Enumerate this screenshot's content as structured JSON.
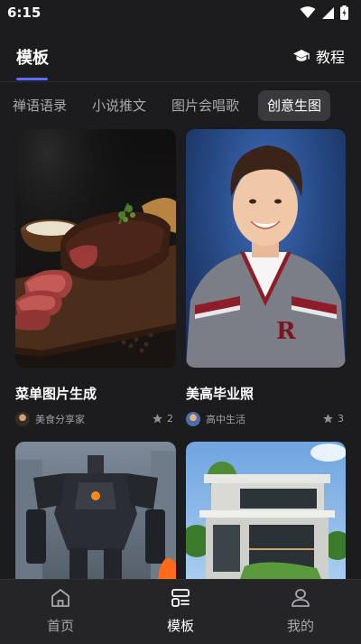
{
  "status": {
    "time": "6:15"
  },
  "header": {
    "title": "模板",
    "tutorial_label": "教程"
  },
  "tabs": [
    {
      "label": "禅语语录"
    },
    {
      "label": "小说推文"
    },
    {
      "label": "图片会唱歌"
    },
    {
      "label": "创意生图",
      "active": true
    }
  ],
  "cards": [
    {
      "title": "菜单图片生成",
      "author": "美食分享家",
      "likes": "2"
    },
    {
      "title": "美高毕业照",
      "author": "高中生活",
      "likes": "3"
    }
  ],
  "nav": [
    {
      "label": "首页",
      "icon": "home-icon"
    },
    {
      "label": "模板",
      "icon": "template-icon",
      "active": true
    },
    {
      "label": "我的",
      "icon": "profile-icon"
    }
  ],
  "colors": {
    "background": "#1c1c1e",
    "accent": "#5b6cff",
    "tab_active_bg": "#3a3a3e"
  }
}
